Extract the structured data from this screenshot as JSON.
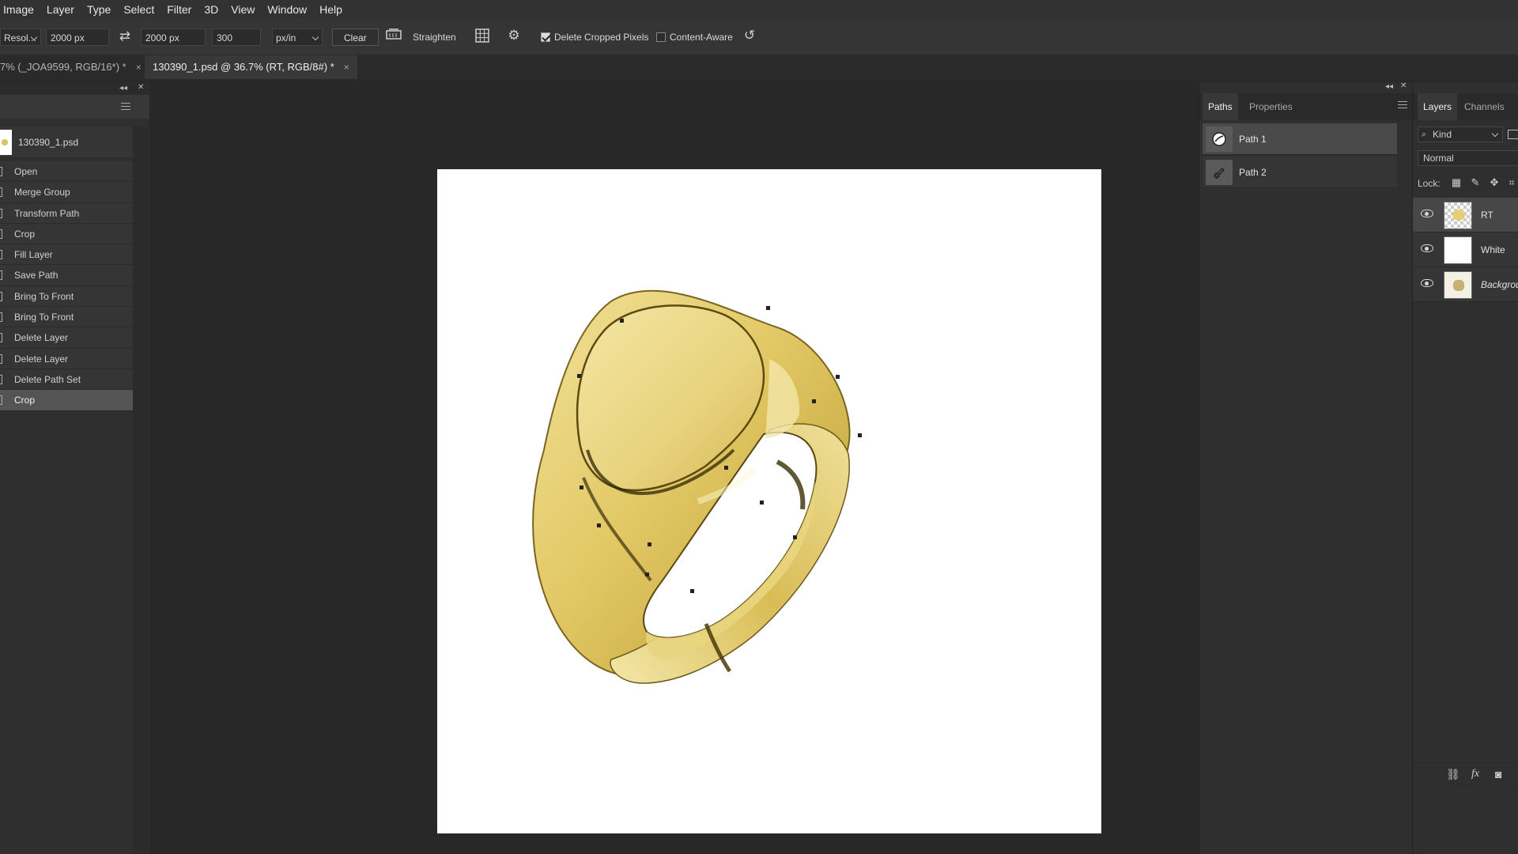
{
  "menu": [
    "Image",
    "Layer",
    "Type",
    "Select",
    "Filter",
    "3D",
    "View",
    "Window",
    "Help"
  ],
  "options": {
    "ratio_preset": "Resol...",
    "width": "2000 px",
    "height": "2000 px",
    "resolution": "300",
    "resolution_unit": "px/in",
    "clear_label": "Clear",
    "straighten_label": "Straighten",
    "delete_cropped_label": "Delete Cropped Pixels",
    "delete_cropped_checked": true,
    "content_aware_label": "Content-Aware",
    "content_aware_checked": false
  },
  "doc_tabs": [
    {
      "label": "7% (_JOA9599, RGB/16*) *",
      "close": "×",
      "active": false
    },
    {
      "label": "130390_1.psd @ 36.7% (RT, RGB/8#) *",
      "close": "×",
      "active": true
    }
  ],
  "history": {
    "snapshot": "130390_1.psd",
    "items": [
      "Open",
      "Merge Group",
      "Transform Path",
      "Crop",
      "Fill Layer",
      "Save Path",
      "Bring To Front",
      "Bring To Front",
      "Delete Layer",
      "Delete Layer",
      "Delete Path Set",
      "Crop"
    ],
    "selected_index": 11
  },
  "paths_panel": {
    "tabs": [
      "Paths",
      "Properties"
    ],
    "active_tab": "Paths",
    "paths": [
      "Path 1",
      "Path 2"
    ],
    "selected_index": 0
  },
  "layers_panel": {
    "tabs": [
      "Layers",
      "Channels"
    ],
    "active_tab": "Layers",
    "filter_label": "Kind",
    "blend_mode": "Normal",
    "lock_label": "Lock:",
    "layers": [
      {
        "name": "RT",
        "visible": true,
        "selected": true
      },
      {
        "name": "White",
        "visible": true,
        "selected": false
      },
      {
        "name": "Background",
        "visible": true,
        "selected": false
      }
    ]
  },
  "colors": {
    "ui_bg": "#282828",
    "panel_bg": "#2f2f2f",
    "selection": "#545454",
    "gold": "#e3cc6b",
    "canvas": "#ffffff"
  },
  "icons": {
    "swap": "swap-icon",
    "straighten": "straighten-icon",
    "grid": "grid-overlay-icon",
    "settings": "gear-icon",
    "reset": "reset-icon"
  }
}
